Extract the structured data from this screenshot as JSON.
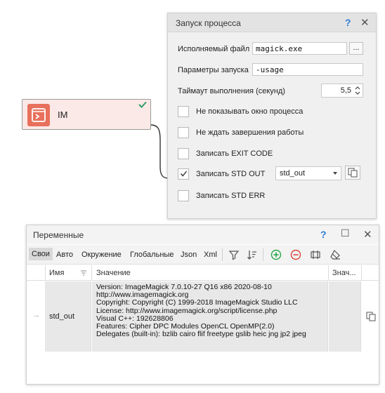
{
  "node": {
    "label": "IM",
    "icon": "console-terminal-icon",
    "status": "success-check-icon",
    "color": "#e8705c"
  },
  "process_dialog": {
    "title": "Запуск процесса",
    "help": "?",
    "close": "✕",
    "executable_label": "Исполняемый файл",
    "executable_value": "magick.exe",
    "browse_label": "...",
    "params_label": "Параметры запуска",
    "params_value": "-usage",
    "timeout_label": "Таймаут выполнения (секунд)",
    "timeout_value": "5,5",
    "options": [
      {
        "label": "Не показывать окно процесса",
        "checked": false
      },
      {
        "label": "Не ждать завершения работы",
        "checked": false
      },
      {
        "label": "Записать EXIT CODE",
        "checked": false
      },
      {
        "label": "Записать STD OUT",
        "checked": true
      },
      {
        "label": "Записать STD ERR",
        "checked": false
      }
    ],
    "stdout_variable": "std_out"
  },
  "variables_panel": {
    "title": "Переменные",
    "help": "?",
    "maximize": "☐",
    "close": "✕",
    "tabs": [
      "Свои",
      "Авто",
      "Окружение",
      "Глобальные",
      "Json",
      "Xml"
    ],
    "active_tab": "Свои",
    "toolbar_icons": [
      "filter-icon",
      "sort-icon",
      "add-icon",
      "remove-icon",
      "columns-icon",
      "clear-icon"
    ],
    "columns": [
      "Имя",
      "Значение",
      "Знач..."
    ],
    "rows": [
      {
        "name": "std_out",
        "value_lines": [
          "Version: ImageMagick 7.0.10-27 Q16 x86 2020-08-10",
          "http://www.imagemagick.org",
          "Copyright: Copyright (C) 1999-2018 ImageMagick Studio LLC",
          "License: http://www.imagemagick.org/script/license.php",
          "Visual C++: 192628806",
          "Features: Cipher DPC Modules OpenCL OpenMP(2.0)",
          "Delegates (built-in): bzlib cairo flif freetype gslib heic jng jp2 jpeg"
        ]
      }
    ]
  },
  "colors": {
    "accent_blue": "#2e7bd6",
    "add_green": "#2aa84a",
    "remove_red": "#d9463b",
    "check_green": "#2f9e69"
  }
}
